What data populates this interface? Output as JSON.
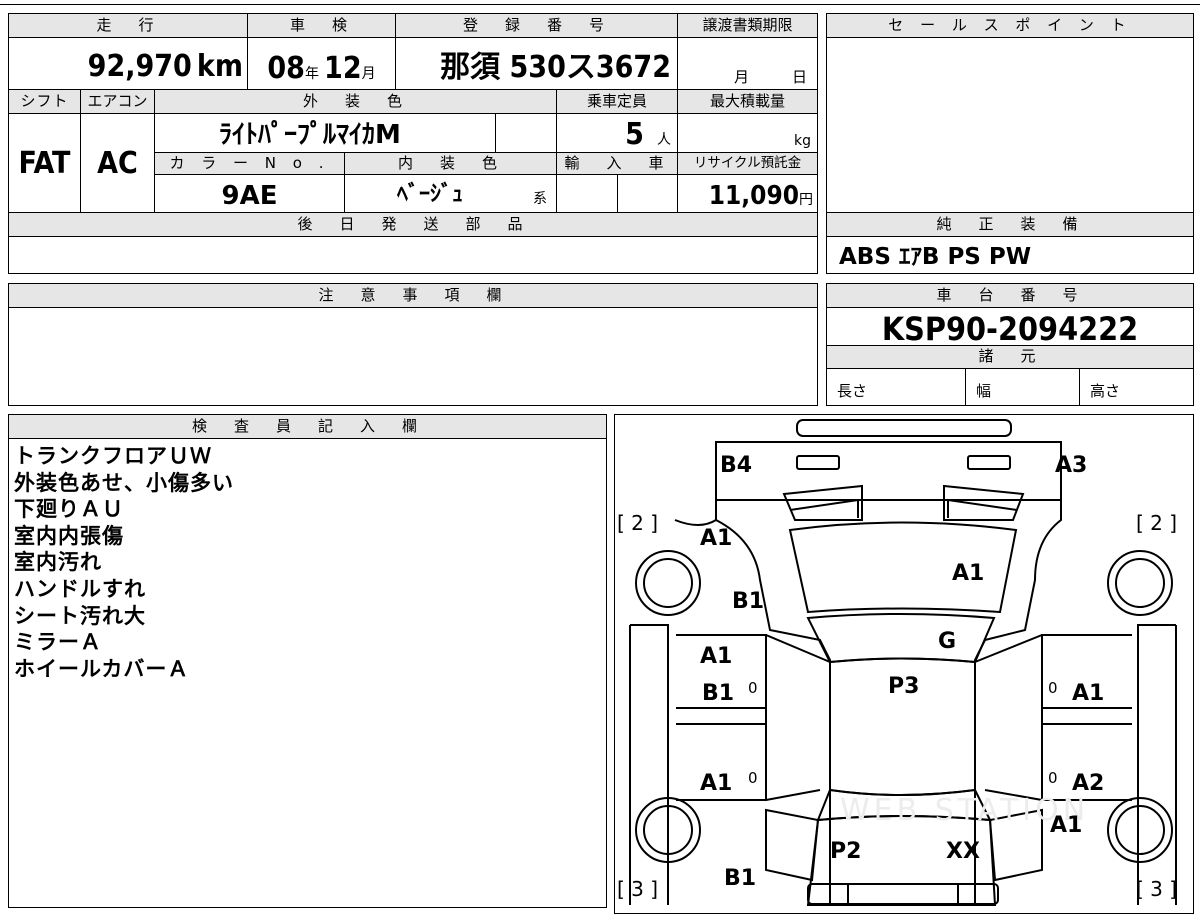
{
  "top_left": {
    "odometer": {
      "label": "走　行",
      "value": "92,970",
      "unit": "km"
    },
    "shaken": {
      "label": "車　検",
      "year": "08",
      "year_unit": "年",
      "month": "12",
      "month_unit": "月"
    },
    "registration": {
      "label": "登　録　番　号",
      "value": "那須 530ス3672"
    },
    "transfer_deadline": {
      "label": "譲渡書類期限",
      "month_unit": "月",
      "day_unit": "日"
    },
    "shift": {
      "label": "シフト",
      "value": "FAT"
    },
    "aircon": {
      "label": "エアコン",
      "value": "AC"
    },
    "exterior_color": {
      "label": "外　装　色",
      "value": "ﾗｲﾄﾊﾟｰﾌﾟﾙﾏｲｶM"
    },
    "color_no": {
      "label": "カ ラ ー  N o .",
      "value": "9AE"
    },
    "interior_color": {
      "label": "内　装　色",
      "value": "ﾍﾞｰｼﾞｭ",
      "suffix": "系"
    },
    "capacity": {
      "label": "乗車定員",
      "value": "5",
      "unit": "人"
    },
    "max_load": {
      "label": "最大積載量",
      "unit": "kg"
    },
    "imported": {
      "label": "輸　入　車"
    },
    "recycle": {
      "label": "リサイクル預託金",
      "value": "11,090",
      "unit": "円"
    },
    "later_parts": {
      "label": "後　日　発　送　部　品"
    },
    "caution": {
      "label": "注　意　事　項　欄"
    },
    "inspector": {
      "label": "検　査　員　記　入　欄"
    }
  },
  "right_panel": {
    "sales_point": {
      "label": "セ ー ル ス ポ イ ン ト"
    },
    "equipment": {
      "label": "純　正　装　備",
      "value": "ABS ｴｱB PS PW"
    },
    "chassis": {
      "label": "車　台　番　号",
      "value": "KSP90-2094222"
    },
    "specs": {
      "label": "諸　元",
      "length": "長さ",
      "width": "幅",
      "height": "高さ"
    }
  },
  "inspector_notes": [
    "トランクフロアＵＷ",
    "外装色あせ、小傷多い",
    "下廻りＡＵ",
    "室内内張傷",
    "室内汚れ",
    "ハンドルすれ",
    "シート汚れ大",
    "ミラーＡ",
    "ホイールカバーＡ"
  ],
  "diagram": {
    "marks": {
      "rear_left": "B4",
      "rear_right": "A3",
      "left_top_bracket": "[ 2 ]",
      "right_top_bracket": "[ 2 ]",
      "left_bottom_bracket": "[ 3 ]",
      "right_bottom_bracket": "[ 3 ]",
      "trunk_left": "A1",
      "quarter_left": "B1",
      "trunk_lid": "A1",
      "rear_glass": "G",
      "roof": "P3",
      "rear_door_left_a": "A1",
      "rear_door_left_b": "B1",
      "rear_door_left_z": "0",
      "rear_door_right_z": "0",
      "rear_door_right": "A1",
      "front_door_left": "A1",
      "front_door_left_z": "0",
      "front_door_right_z": "0",
      "front_door_right": "A2",
      "front_fender_right": "A1",
      "hood": "P2",
      "windshield": "XX",
      "front_fender_left": "B1"
    },
    "watermark": "WEB STATION"
  }
}
